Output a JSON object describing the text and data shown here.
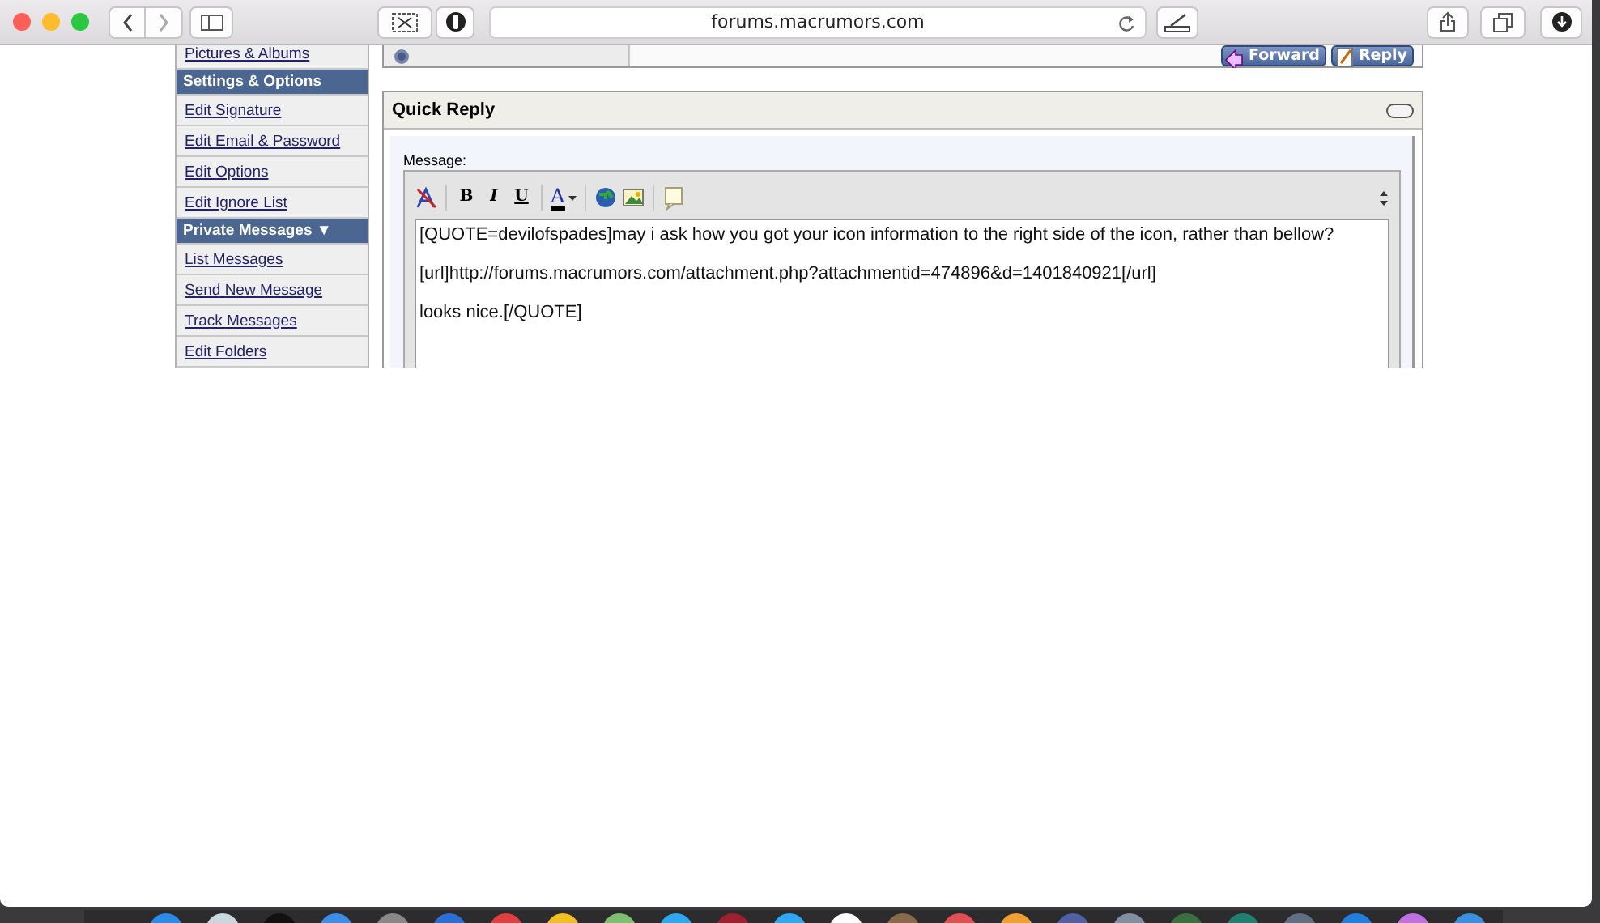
{
  "browser": {
    "address": "forums.macrumors.com"
  },
  "sidebar": {
    "items": [
      {
        "kind": "link",
        "label": "Pictures & Albums"
      },
      {
        "kind": "header",
        "label": "Settings & Options"
      },
      {
        "kind": "link",
        "label": "Edit Signature"
      },
      {
        "kind": "link",
        "label": "Edit Email & Password"
      },
      {
        "kind": "link",
        "label": "Edit Options"
      },
      {
        "kind": "link",
        "label": "Edit Ignore List"
      },
      {
        "kind": "header",
        "label": "Private Messages",
        "toggle": "▼"
      },
      {
        "kind": "link",
        "label": "List Messages"
      },
      {
        "kind": "link",
        "label": "Send New Message"
      },
      {
        "kind": "link",
        "label": "Track Messages"
      },
      {
        "kind": "link",
        "label": "Edit Folders"
      }
    ]
  },
  "post_footer": {
    "buttons": [
      {
        "label": "Forward"
      },
      {
        "label": "Reply"
      }
    ]
  },
  "quick_reply": {
    "title": "Quick Reply",
    "field_label": "Message:",
    "toolbar": [
      {
        "kind": "remove-format"
      },
      {
        "kind": "bold",
        "label": "B"
      },
      {
        "kind": "italic",
        "label": "I"
      },
      {
        "kind": "underline",
        "label": "U"
      },
      {
        "kind": "color",
        "label": "A"
      },
      {
        "kind": "link"
      },
      {
        "kind": "image"
      },
      {
        "kind": "quote"
      }
    ],
    "value": "[QUOTE=devilofspades]may i ask how you got your icon information to the right side of the icon, rather than bellow?\n\n[url]http://forums.macrumors.com/attachment.php?attachmentid=474896&d=1401840921[/url]\n\nlooks nice.[/QUOTE]"
  }
}
